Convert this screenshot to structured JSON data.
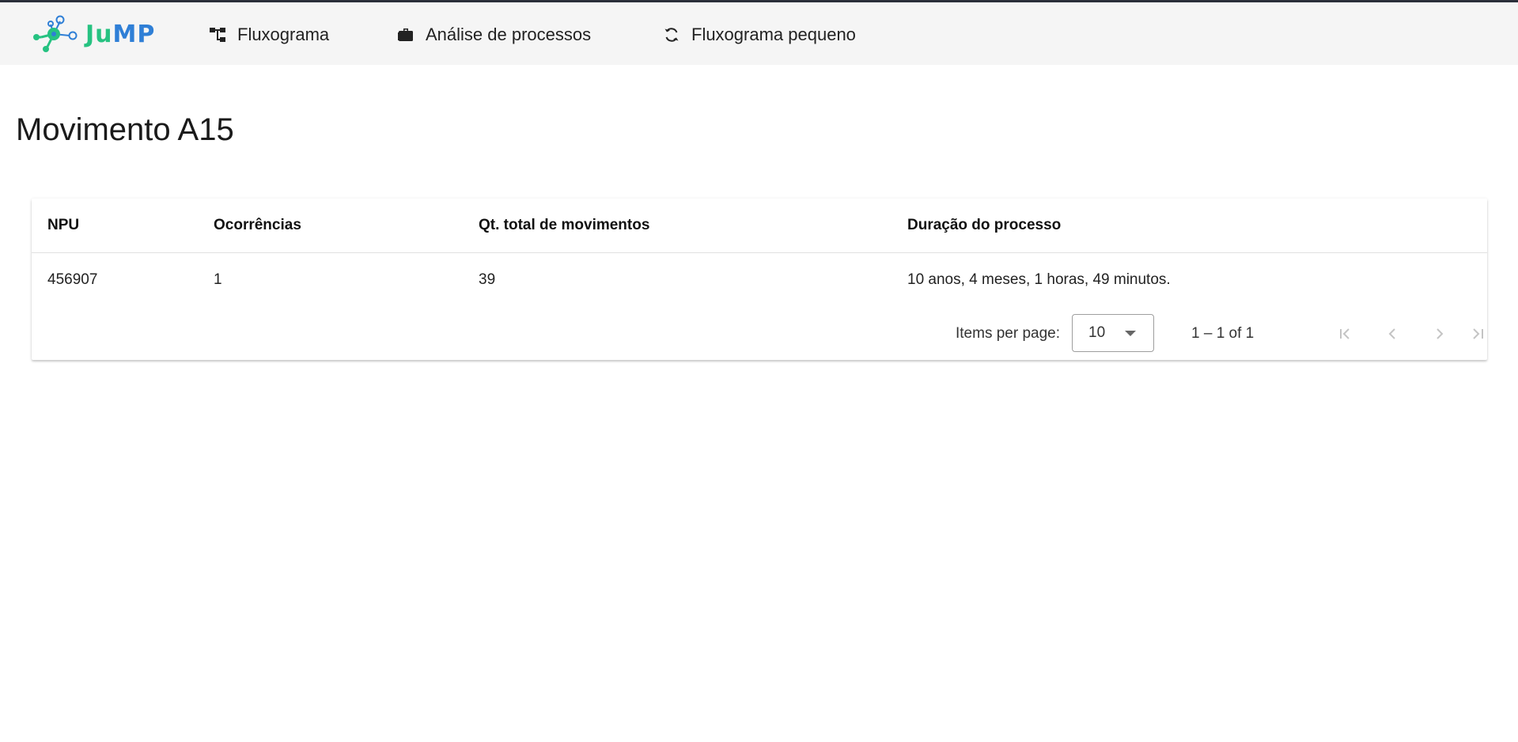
{
  "topbar": {
    "logo": {
      "text_part1": "Ju",
      "text_part2": "MP",
      "colors": {
        "green": "#26c281",
        "blue": "#2f7fd6"
      }
    },
    "nav": [
      {
        "label": "Fluxograma",
        "icon": "flowchart-icon"
      },
      {
        "label": "Análise de processos",
        "icon": "briefcase-icon"
      },
      {
        "label": "Fluxograma pequeno",
        "icon": "refresh-icon"
      }
    ]
  },
  "main": {
    "title": "Movimento A15",
    "table": {
      "columns": [
        "NPU",
        "Ocorrências",
        "Qt. total de movimentos",
        "Duração do processo"
      ],
      "rows": [
        [
          "456907",
          "1",
          "39",
          "10 anos, 4 meses, 1 horas, 49 minutos."
        ]
      ]
    },
    "paginator": {
      "items_per_page_label": "Items per page:",
      "items_per_page_value": "10",
      "range_label": "1 – 1 of 1",
      "buttons": [
        "first-page-icon",
        "previous-page-icon",
        "next-page-icon",
        "last-page-icon"
      ]
    }
  }
}
